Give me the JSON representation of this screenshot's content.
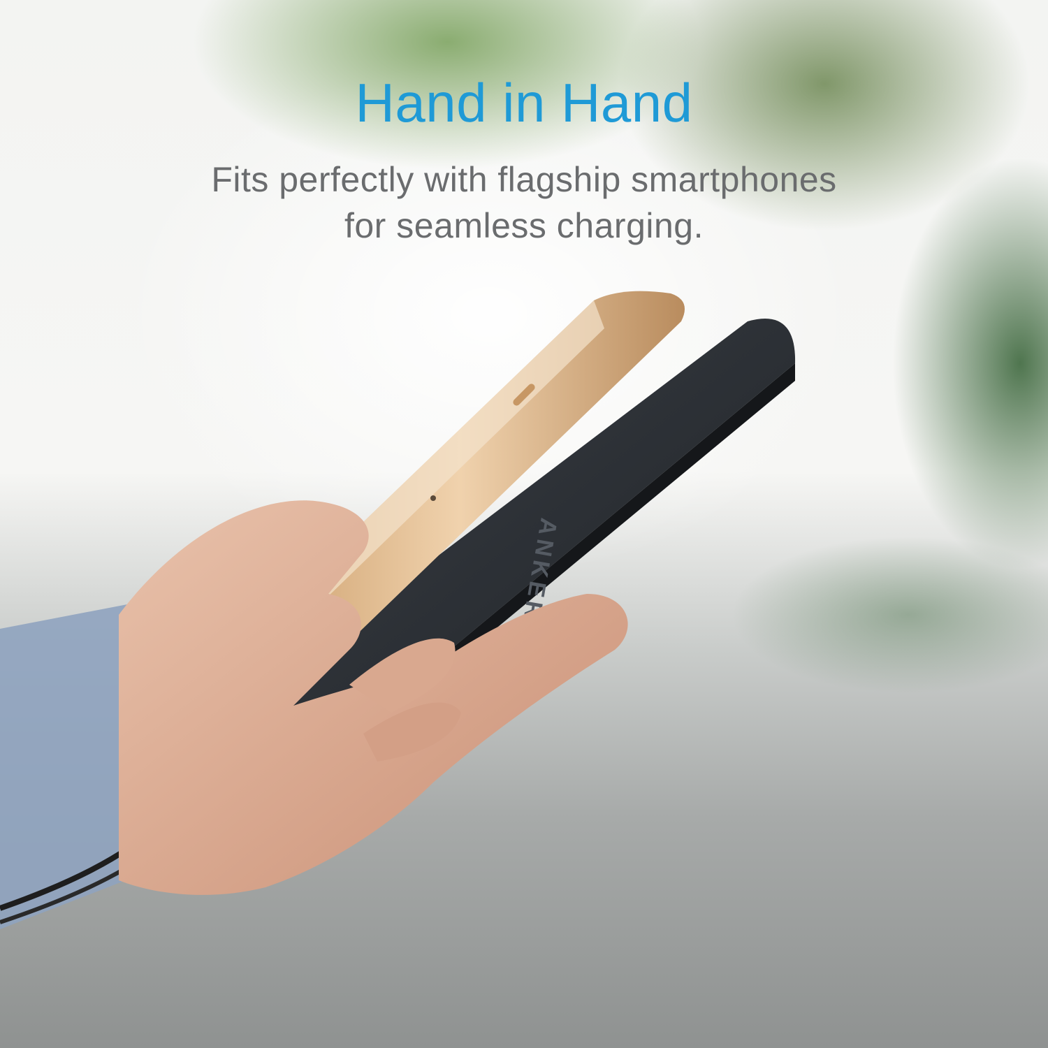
{
  "headline": "Hand in Hand",
  "subheadline": {
    "line1": "Fits perfectly with flagship smartphones",
    "line2": "for seamless charging."
  },
  "product_logo_text": "ANKER",
  "colors": {
    "headline": "#1f9ad6",
    "subheadline": "#6a6c6e",
    "phone_body": "#d8b48c",
    "power_bank": "#2b2f35"
  }
}
